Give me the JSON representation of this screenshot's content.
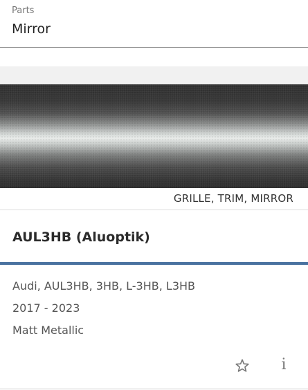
{
  "parts_field": {
    "label": "Parts",
    "value": "Mirror"
  },
  "card": {
    "category": "GRILLE, TRIM, MIRROR",
    "title": "AUL3HB (Aluoptik)",
    "details": {
      "codes": "Audi, AUL3HB, 3HB, L-3HB, L3HB",
      "years": "2017 - 2023",
      "finish": "Matt Metallic"
    },
    "actions": {
      "favorite_icon": "star-outline-icon",
      "info_icon": "info-icon",
      "info_glyph": "i"
    },
    "accent_color": "#4a72a0"
  }
}
